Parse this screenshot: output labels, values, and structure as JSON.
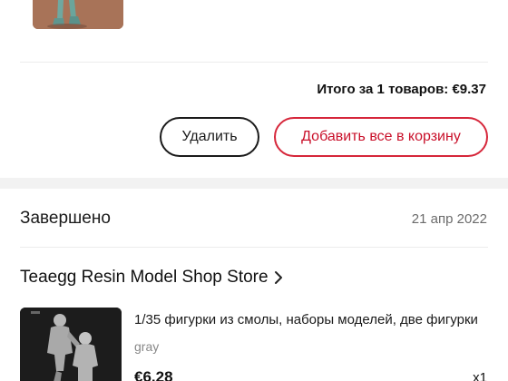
{
  "top_order": {
    "total_text": "Итого за 1 товаров: €9.37",
    "delete_label": "Удалить",
    "add_all_label": "Добавить все в корзину"
  },
  "completed_order": {
    "status": "Завершено",
    "date": "21 апр 2022",
    "store_name": "Teaegg Resin Model Shop Store",
    "item": {
      "title": "1/35 фигурки из смолы, наборы моделей, две фигурки",
      "variant": "gray",
      "price": "€6.28",
      "quantity": "x1"
    }
  },
  "icons": {
    "store_link": "chevron-right-icon"
  },
  "colors": {
    "accent_red": "#c9102a",
    "button_dark": "#1a1a1a",
    "muted_text": "#6b6b6b",
    "section_gap": "#f2f2f2"
  }
}
